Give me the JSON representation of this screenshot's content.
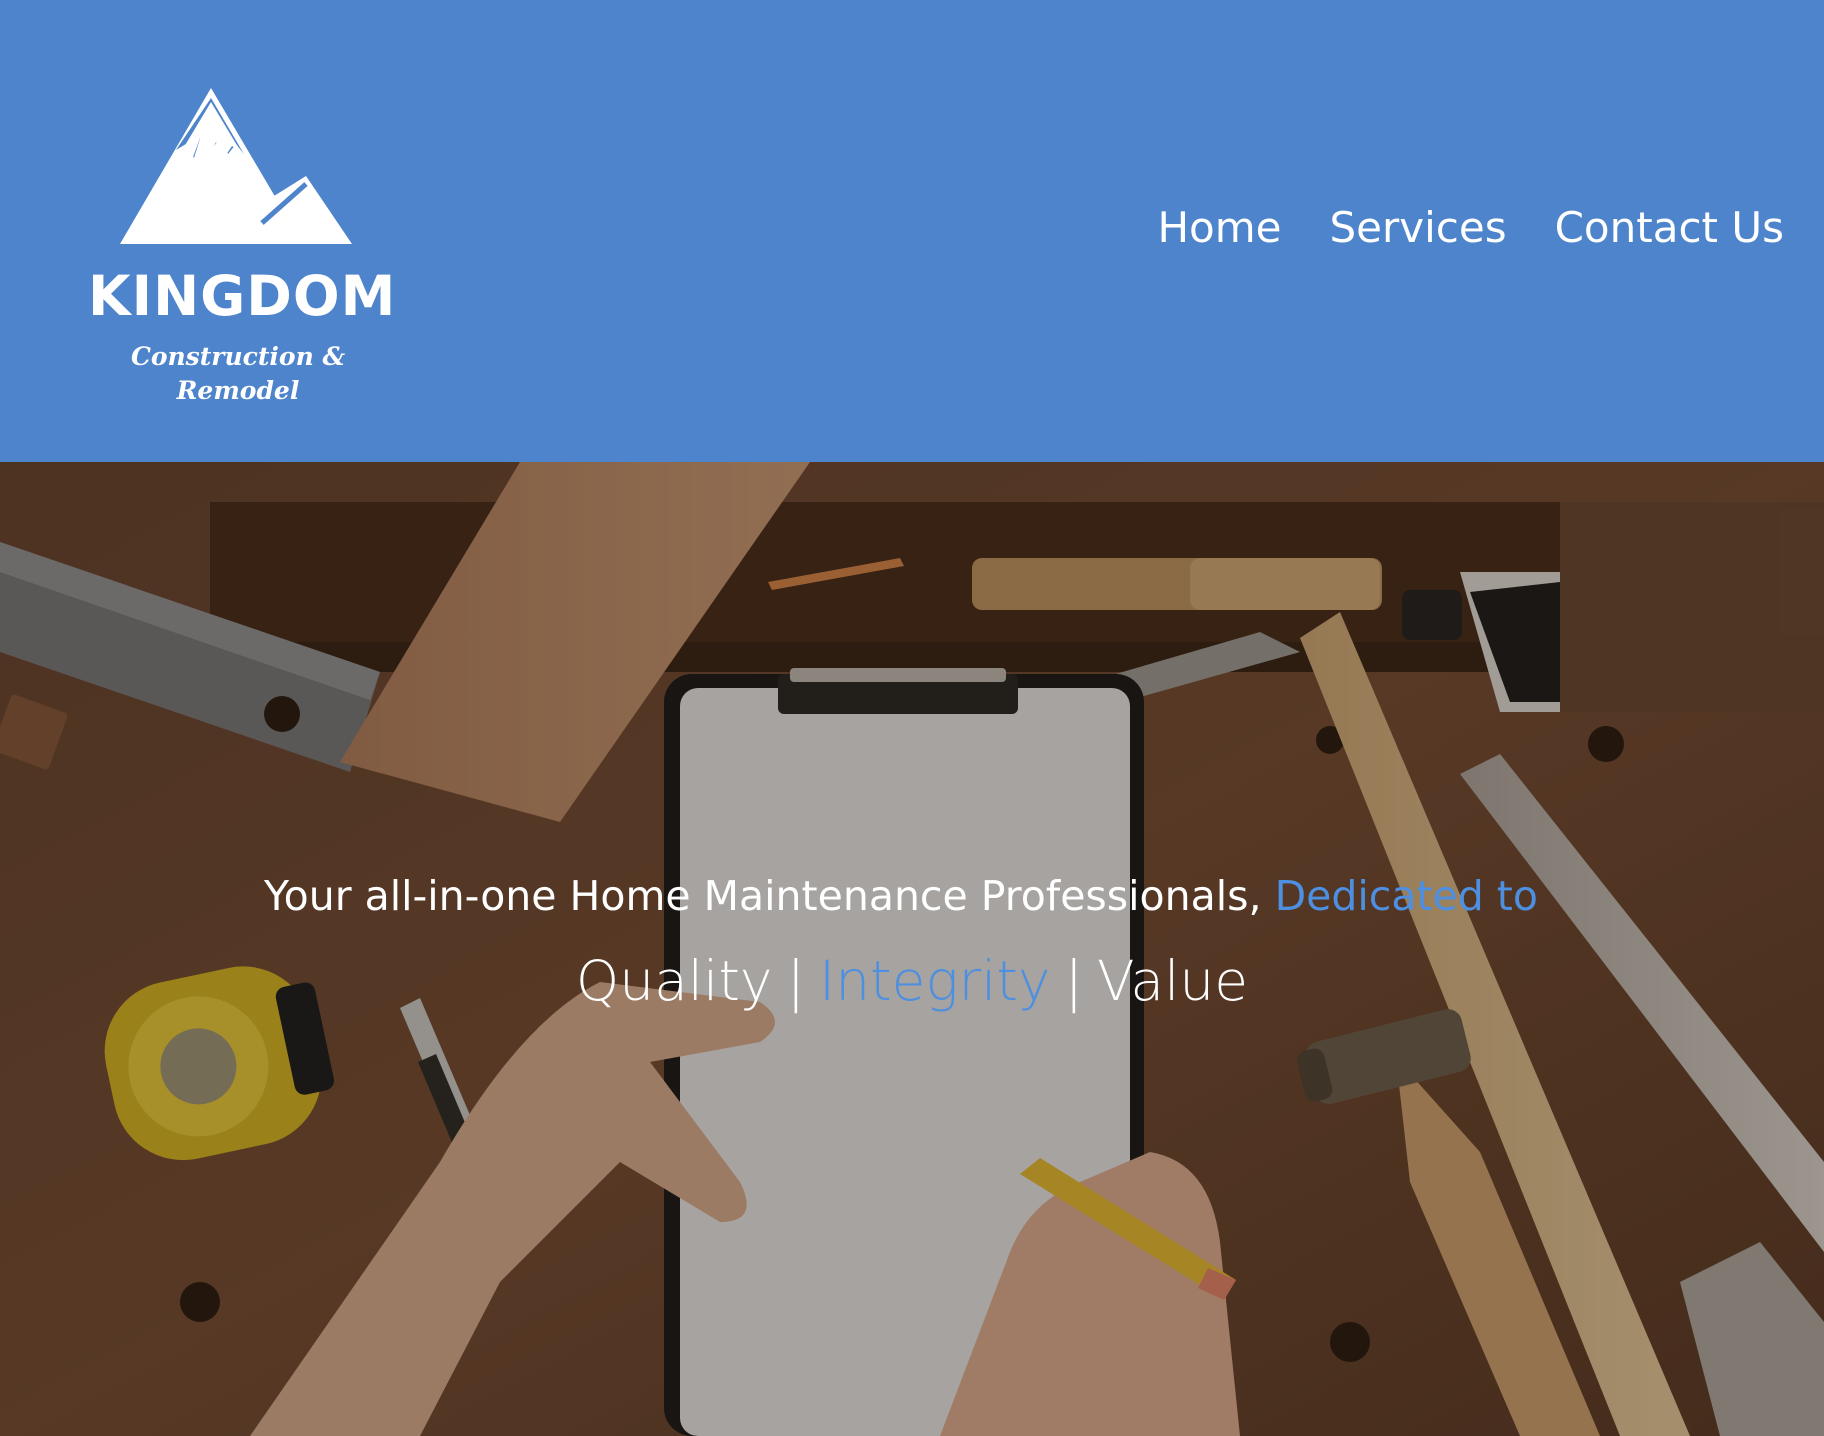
{
  "logo": {
    "title": "KINGDOM",
    "subtitle": "Construction & Remodel",
    "icon": "mountain-peak-icon"
  },
  "nav": {
    "items": [
      {
        "label": "Home"
      },
      {
        "label": "Services"
      },
      {
        "label": "Contact Us"
      }
    ]
  },
  "hero": {
    "tagline_main": "Your all-in-one Home Maintenance Professionals, ",
    "tagline_accent": "Dedicated to",
    "values": [
      {
        "label": "Quality"
      },
      {
        "label": "Integrity"
      },
      {
        "label": "Value"
      }
    ],
    "separator": "|",
    "background": "workbench-with-tools-and-clipboard-photo"
  },
  "colors": {
    "header_bg": "#4d84cb",
    "accent": "#4d8fe0",
    "text": "#ffffff"
  }
}
